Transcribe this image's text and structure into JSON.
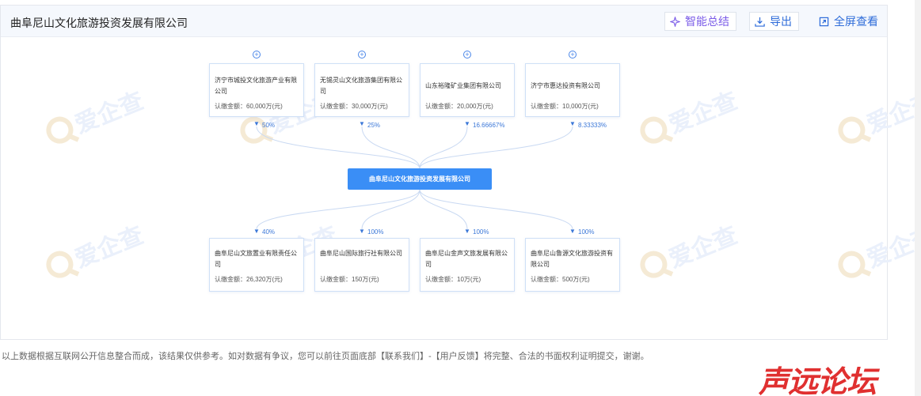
{
  "header": {
    "title": "曲阜尼山文化旅游投资发展有限公司",
    "smart_summary": "智能总结",
    "export": "导出",
    "fullscreen": "全屏查看"
  },
  "watermark": "爱企查",
  "center_company": "曲阜尼山文化旅游投资发展有限公司",
  "shareholders": [
    {
      "name": "济宁市城投文化旅游产业有限公司",
      "amount": "认缴金额：60,000万(元)",
      "percent": "50%"
    },
    {
      "name": "无锡灵山文化旅游集团有限公司",
      "amount": "认缴金额：30,000万(元)",
      "percent": "25%"
    },
    {
      "name": "山东裕隆矿业集团有限公司",
      "amount": "认缴金额：20,000万(元)",
      "percent": "16.66667%"
    },
    {
      "name": "济宁市惠达投资有限公司",
      "amount": "认缴金额：10,000万(元)",
      "percent": "8.33333%"
    }
  ],
  "investments": [
    {
      "name": "曲阜尼山文旅置业有限责任公司",
      "amount": "认缴金额：26,320万(元)",
      "percent": "40%"
    },
    {
      "name": "曲阜尼山国际旅行社有限公司",
      "amount": "认缴金额：150万(元)",
      "percent": "100%"
    },
    {
      "name": "曲阜尼山金声文旅发展有限公司",
      "amount": "认缴金额：10万(元)",
      "percent": "100%"
    },
    {
      "name": "曲阜尼山鲁源文化旅游投资有限公司",
      "amount": "认缴金额：500万(元)",
      "percent": "100%"
    }
  ],
  "footer_note": "以上数据根据互联网公开信息整合而成，该结果仅供参考。如对数据有争议，您可以前往页面底部【联系我们】-【用户反馈】将完整、合法的书面权利证明提交，谢谢。",
  "forum_logo": "声远论坛",
  "colors": {
    "accent": "#3a8ef6",
    "link": "#2d6bd9",
    "smart": "#7b5ce8",
    "logo": "#e03030"
  }
}
